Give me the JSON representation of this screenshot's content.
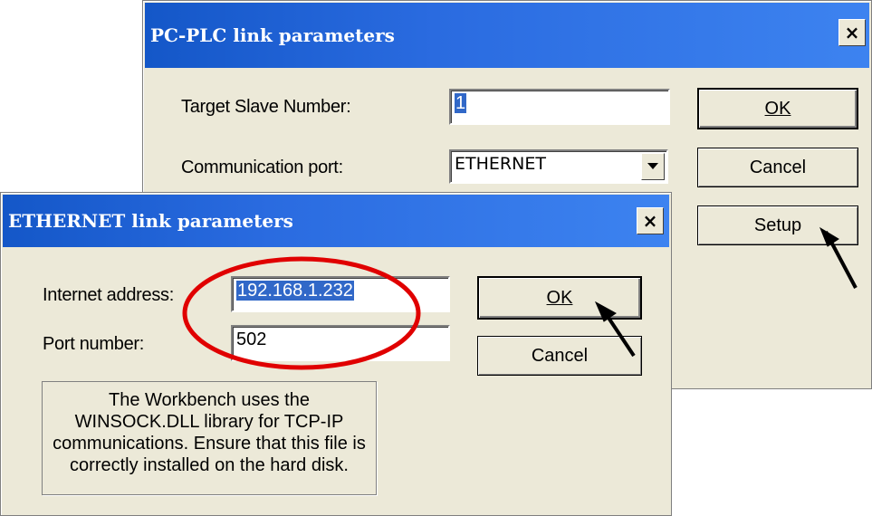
{
  "plc_dialog": {
    "title": "PC-PLC link parameters",
    "close_label": "×",
    "target_slave_label": "Target Slave Number:",
    "target_slave_value": "1",
    "comm_port_label": "Communication port:",
    "comm_port_value": "ETHERNET",
    "ok_label": "OK",
    "cancel_label": "Cancel",
    "setup_label": "Setup"
  },
  "ethernet_dialog": {
    "title": "ETHERNET link parameters",
    "close_label": "×",
    "internet_address_label": "Internet address:",
    "internet_address_value": "192.168.1.232",
    "port_number_label": "Port number:",
    "port_number_value": "502",
    "ok_label": "OK",
    "cancel_label": "Cancel",
    "info_text": "The Workbench uses the WINSOCK.DLL library for TCP-IP communications. Ensure that this file is correctly installed on the hard disk."
  },
  "annotation_color": "#e00000"
}
